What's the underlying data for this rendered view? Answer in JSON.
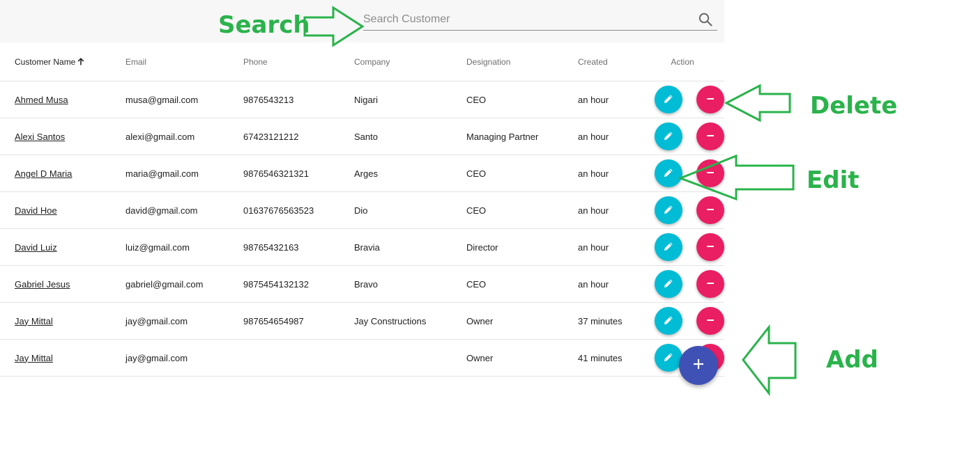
{
  "search": {
    "placeholder": "Search Customer",
    "value": "",
    "icon": "search-icon"
  },
  "table": {
    "columns": [
      {
        "key": "name",
        "label": "Customer Name",
        "sorted": "ascending"
      },
      {
        "key": "email",
        "label": "Email"
      },
      {
        "key": "phone",
        "label": "Phone"
      },
      {
        "key": "company",
        "label": "Company"
      },
      {
        "key": "designation",
        "label": "Designation"
      },
      {
        "key": "created",
        "label": "Created"
      },
      {
        "key": "action",
        "label": "Action"
      }
    ],
    "rows": [
      {
        "name": "Ahmed Musa",
        "email": "musa@gmail.com",
        "phone": "9876543213",
        "company": "Nigari",
        "designation": "CEO",
        "created": "an hour"
      },
      {
        "name": "Alexi Santos",
        "email": "alexi@gmail.com",
        "phone": "67423121212",
        "company": "Santo",
        "designation": "Managing Partner",
        "created": "an hour"
      },
      {
        "name": "Angel D Maria",
        "email": "maria@gmail.com",
        "phone": "9876546321321",
        "company": "Arges",
        "designation": "CEO",
        "created": "an hour"
      },
      {
        "name": "David Hoe",
        "email": "david@gmail.com",
        "phone": "01637676563523",
        "company": "Dio",
        "designation": "CEO",
        "created": "an hour"
      },
      {
        "name": "David Luiz",
        "email": "luiz@gmail.com",
        "phone": "98765432163",
        "company": "Bravia",
        "designation": "Director",
        "created": "an hour"
      },
      {
        "name": "Gabriel Jesus",
        "email": "gabriel@gmail.com",
        "phone": "9875454132132",
        "company": "Bravo",
        "designation": "CEO",
        "created": "an hour"
      },
      {
        "name": "Jay Mittal",
        "email": "jay@gmail.com",
        "phone": "987654654987",
        "company": "Jay Constructions",
        "designation": "Owner",
        "created": "37 minutes"
      },
      {
        "name": "Jay Mittal",
        "email": "jay@gmail.com",
        "phone": "",
        "company": "",
        "designation": "Owner",
        "created": "41 minutes"
      }
    ],
    "row_actions": {
      "edit_icon": "pencil-icon",
      "delete_icon": "minus-icon"
    }
  },
  "add_button": {
    "icon": "plus-icon"
  },
  "annotations": {
    "search_label": "Search",
    "delete_label": "Delete",
    "edit_label": "Edit",
    "add_label": "Add"
  },
  "colors": {
    "edit_button": "#00bcd4",
    "delete_button": "#e91e63",
    "add_button": "#3f51b5",
    "annotation": "#2ab34b",
    "search_bar_bg": "#f7f7f7"
  }
}
